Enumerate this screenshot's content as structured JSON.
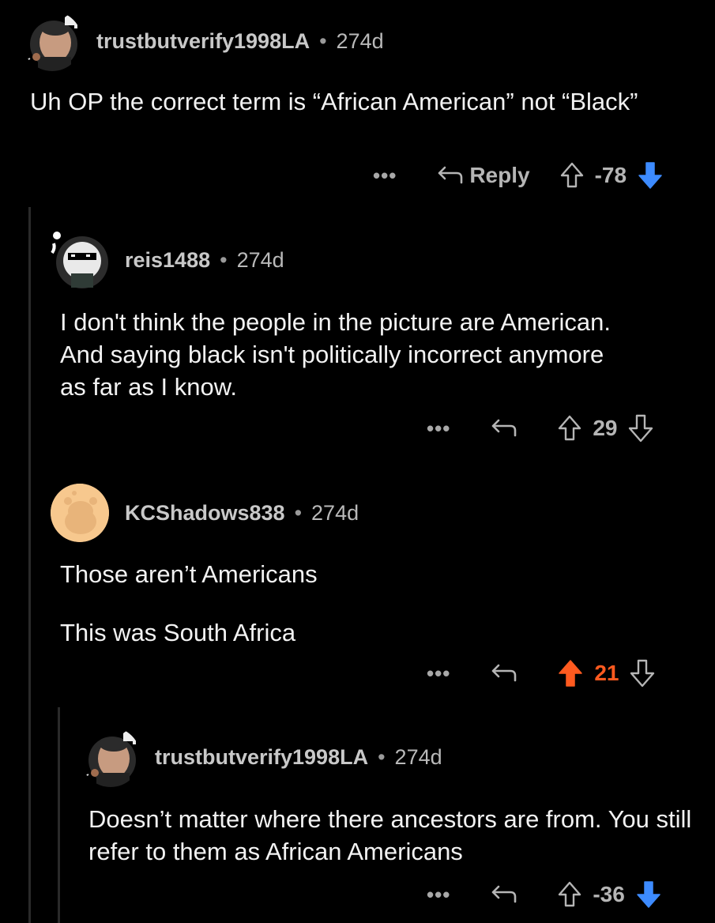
{
  "comments": [
    {
      "username": "trustbutverify1998LA",
      "separator": "•",
      "age": "274d",
      "body": [
        "Uh OP the correct term is “African American” not “Black”"
      ],
      "more": "•••",
      "reply_label": "Reply",
      "score": "-78",
      "vote": "down",
      "vote_color": "#3d8bff"
    },
    {
      "username": "reis1488",
      "separator": "•",
      "age": "274d",
      "body": [
        "I don't think the people in the picture are American. And saying black isn't politically incorrect anymore as far as I know."
      ],
      "more": "•••",
      "score": "29",
      "vote": "none"
    },
    {
      "username": "KCShadows838",
      "separator": "•",
      "age": "274d",
      "body": [
        "Those aren’t Americans",
        "This was South Africa"
      ],
      "more": "•••",
      "score": "21",
      "vote": "up",
      "vote_color": "#ff5a1f"
    },
    {
      "username": "trustbutverify1998LA",
      "separator": "•",
      "age": "274d",
      "body": [
        "Doesn’t matter where there ancestors are from. You still refer to them as African Americans"
      ],
      "more": "•••",
      "score": "-36",
      "vote": "down",
      "vote_color": "#3d8bff"
    }
  ],
  "icons": {
    "reply": "reply-arrow-icon",
    "upvote": "upvote-arrow-icon",
    "downvote": "downvote-arrow-icon"
  }
}
